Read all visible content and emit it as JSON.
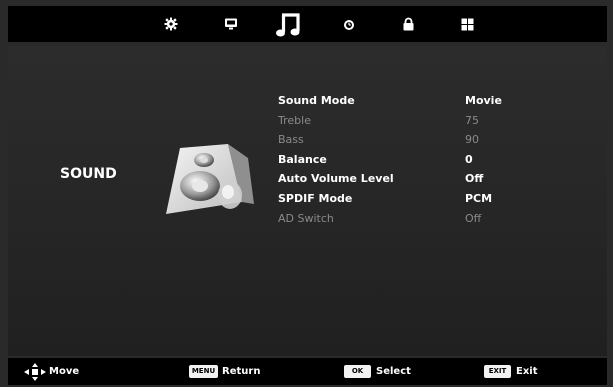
{
  "colors": {
    "background": "#000000",
    "panel": "#262626",
    "active_text": "#ffffff",
    "inactive_text": "#8a8a8a"
  },
  "tabs": [
    {
      "name": "picture",
      "icon": "gear-icon",
      "active": false
    },
    {
      "name": "screen",
      "icon": "monitor-icon",
      "active": false
    },
    {
      "name": "sound",
      "icon": "music-note-icon",
      "active": true
    },
    {
      "name": "time",
      "icon": "clock-icon",
      "active": false
    },
    {
      "name": "lock",
      "icon": "lock-icon",
      "active": false
    },
    {
      "name": "setup",
      "icon": "grid-icon",
      "active": false
    }
  ],
  "section": {
    "title": "SOUND",
    "icon": "speaker-icon"
  },
  "menu": [
    {
      "label": "Sound Mode",
      "value": "Movie",
      "enabled": true
    },
    {
      "label": "Treble",
      "value": "75",
      "enabled": false
    },
    {
      "label": "Bass",
      "value": "90",
      "enabled": false
    },
    {
      "label": "Balance",
      "value": "0",
      "enabled": true
    },
    {
      "label": "Auto Volume Level",
      "value": "Off",
      "enabled": true
    },
    {
      "label": "SPDIF Mode",
      "value": "PCM",
      "enabled": true
    },
    {
      "label": "AD Switch",
      "value": "Off",
      "enabled": false
    }
  ],
  "hints": {
    "move": {
      "icon": "dpad-icon",
      "label": "Move"
    },
    "return": {
      "key": "MENU",
      "label": "Return"
    },
    "select": {
      "key": "OK",
      "label": "Select"
    },
    "exit": {
      "key": "EXIT",
      "label": "Exit"
    }
  }
}
